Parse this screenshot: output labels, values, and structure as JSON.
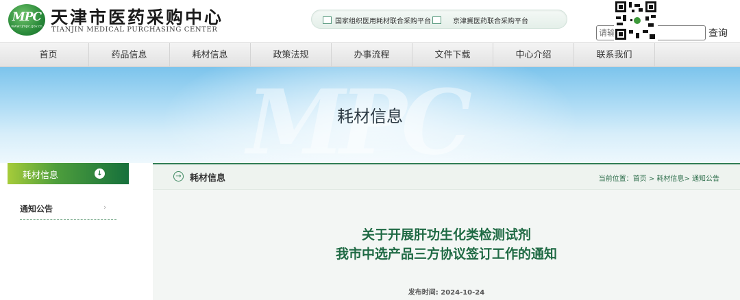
{
  "header": {
    "logo_mark": "MPC",
    "logo_mark_url": "www.tjmpc.gov.cn",
    "logo_cn": "天津市医药采购中心",
    "logo_en": "TIANJIN MEDICAL PURCHASING CENTER",
    "platforms": [
      "国家组织医用耗材联合采购平台",
      "京津冀医药联合采购平台"
    ],
    "search_placeholder": "请输",
    "search_button": "查询"
  },
  "nav": {
    "items": [
      "首页",
      "药品信息",
      "耗材信息",
      "政策法规",
      "办事流程",
      "文件下载",
      "中心介绍",
      "联系我们"
    ]
  },
  "banner": {
    "watermark": "MPC",
    "title": "耗材信息"
  },
  "sidebar": {
    "header_label": "耗材信息",
    "header_icon": "arrow-down-circle-icon",
    "items": [
      {
        "label": "通知公告"
      }
    ]
  },
  "main": {
    "section_title": "耗材信息",
    "breadcrumb": {
      "prefix": "当前位置：",
      "home": "首页",
      "sep1": " > ",
      "section": "耗材信息",
      "sep2": "> ",
      "current": "通知公告"
    },
    "article": {
      "title_line1": "关于开展肝功生化类检测试剂",
      "title_line2": "我市中选产品三方协议签订工作的通知",
      "date": "发布时间: 2024-10-24"
    }
  },
  "colors": {
    "brand_green": "#1f6a44",
    "banner_blue": "#7cc4ec",
    "sidebar_gradient_start": "#a6cc3a",
    "sidebar_gradient_end": "#16703c"
  }
}
